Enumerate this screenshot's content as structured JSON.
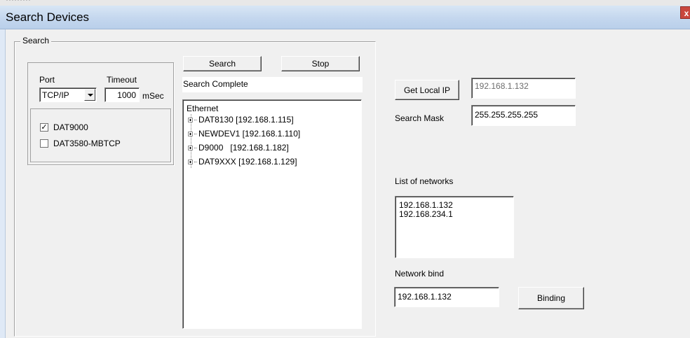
{
  "window": {
    "title": "Search Devices",
    "close_glyph": "x",
    "background_title_fragment": "·········"
  },
  "search_group": {
    "label": "Search"
  },
  "port": {
    "label": "Port",
    "value": "TCP/IP"
  },
  "timeout": {
    "label": "Timeout",
    "value": "1000",
    "unit": "mSec"
  },
  "devices": [
    {
      "label": "DAT9000",
      "checked": true,
      "mark": "✓"
    },
    {
      "label": "DAT3580-MBTCP",
      "checked": false,
      "mark": ""
    }
  ],
  "actions": {
    "search_label": "Search",
    "stop_label": "Stop"
  },
  "status": {
    "text": "Search Complete"
  },
  "tree": {
    "root": "Ethernet",
    "nodes": [
      "DAT8130 [192.168.1.115]",
      "NEWDEV1 [192.168.1.110]",
      "D9000   [192.168.1.182]",
      "DAT9XXX [192.168.1.129]"
    ]
  },
  "local_ip": {
    "button_label": "Get Local IP",
    "value": "192.168.1.132"
  },
  "search_mask": {
    "label": "Search Mask",
    "value": "255.255.255.255"
  },
  "networks": {
    "label": "List of networks",
    "items": [
      "192.168.1.132",
      "192.168.234.1"
    ]
  },
  "network_bind": {
    "label": "Network bind",
    "value": "192.168.1.132",
    "button_label": "Binding"
  },
  "colors": {
    "title_gradient_top": "#d8e6f5",
    "title_gradient_bottom": "#b9cfea",
    "close_button": "#c9463d",
    "dialog_bg": "#f0f0f0"
  }
}
